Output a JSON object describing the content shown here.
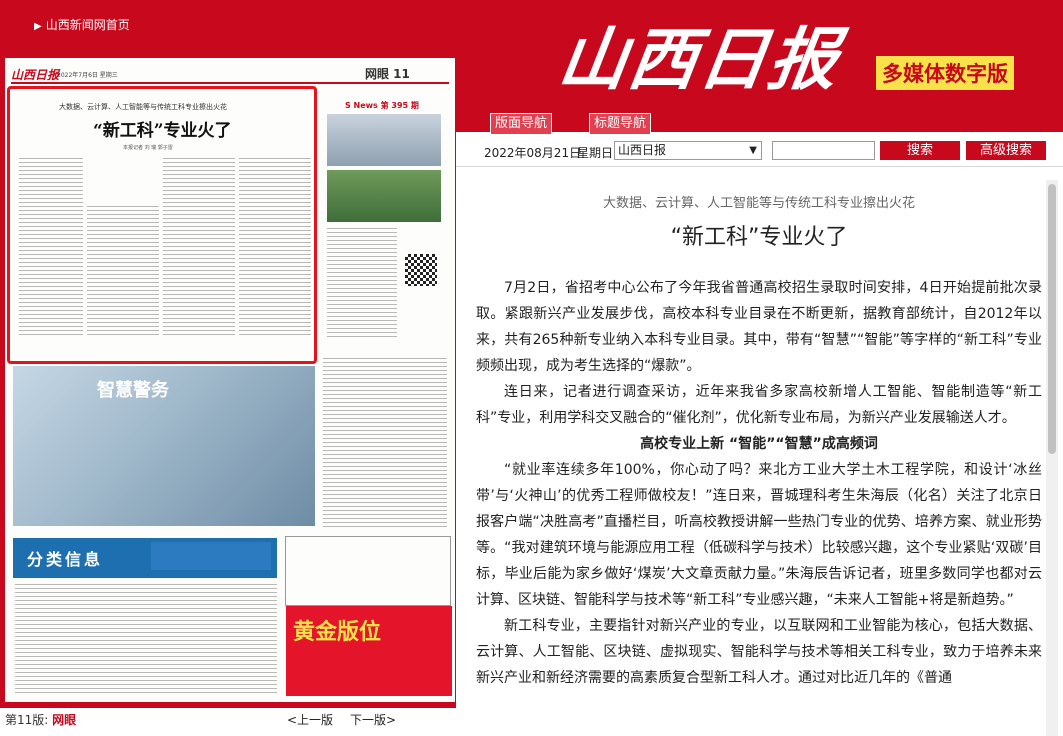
{
  "header": {
    "home_link": "山西新闻网首页",
    "logo_text": "山西日报",
    "media_tag": "多媒体数字版",
    "nav": {
      "layout_label": "版面导航",
      "title_label": "标题导航"
    }
  },
  "search": {
    "date": "2022年08月21日",
    "weekday": "星期日",
    "paper_selected": "山西日报",
    "query_value": "",
    "search_label": "搜索",
    "advanced_label": "高级搜索"
  },
  "page_viewer": {
    "page_label": "第11版:",
    "page_name": "网眼",
    "prev_label": "<上一版",
    "next_label": "下一版>",
    "thumbnail": {
      "masthead": "山西日报",
      "date": "2022年7月6日 星期三",
      "section": "网眼 11",
      "subhead": "大数据、云计算、人工智能等与传统工科专业擦出火花",
      "headline": "“新工科”专业火了",
      "byline": "本报记者 刘 瑞 郭子雷",
      "news_tag": "S News 第 395 期",
      "police_sign": "智慧警务",
      "classified": "分类信息",
      "gold": "黄金版位"
    }
  },
  "article": {
    "subtitle": "大数据、云计算、人工智能等与传统工科专业擦出火花",
    "title": "“新工科”专业火了",
    "p1": "7月2日，省招考中心公布了今年我省普通高校招生录取时间安排，4日开始提前批次录取。紧跟新兴产业发展步伐，高校本科专业目录在不断更新，据教育部统计，自2012年以来，共有265种新专业纳入本科专业目录。其中，带有“智慧”“智能”等字样的“新工科”专业频频出现，成为考生选择的“爆款”。",
    "p2": "连日来，记者进行调查采访，近年来我省多家高校新增人工智能、智能制造等“新工科”专业，利用学科交叉融合的“催化剂”，优化新专业布局，为新兴产业发展输送人才。",
    "section_head": "高校专业上新 “智能”“智慧”成高频词",
    "p3": "“就业率连续多年100%，你心动了吗？来北方工业大学土木工程学院，和设计‘冰丝带’与‘火神山’的优秀工程师做校友！”连日来，晋城理科考生朱海辰（化名）关注了北京日报客户端“决胜高考”直播栏目，听高校教授讲解一些热门专业的优势、培养方案、就业形势等。“我对建筑环境与能源应用工程（低碳科学与技术）比较感兴趣，这个专业紧贴‘双碳’目标，毕业后能为家乡做好‘煤炭’大文章贡献力量。”朱海辰告诉记者，班里多数同学也都对云计算、区块链、智能科学与技术等“新工科”专业感兴趣，“未来人工智能+将是新趋势。”",
    "p4": "新工科专业，主要指针对新兴产业的专业，以互联网和工业智能为核心，包括大数据、云计算、人工智能、区块链、虚拟现实、智能科学与技术等相关工科专业，致力于培养未来新兴产业和新经济需要的高素质复合型新工科人才。通过对比近几年的《普通"
  },
  "colors": {
    "brand_red": "#c8081c",
    "tag_yellow": "#f7e24a",
    "highlight_red": "#e5141c"
  }
}
